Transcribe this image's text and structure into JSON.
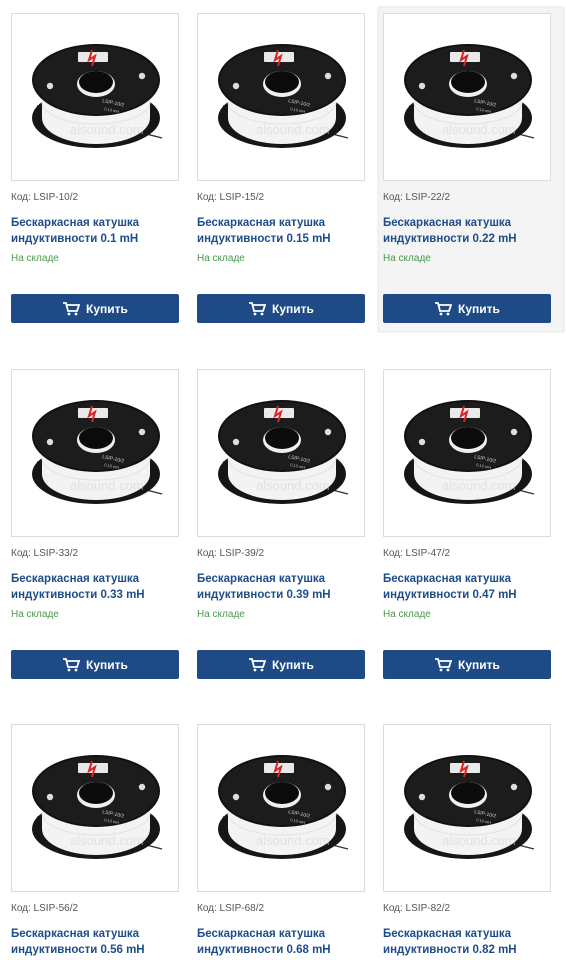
{
  "products": [
    {
      "code": "Код: LSIP-10/2",
      "title": "Бескаркасная катушка индуктивности 0.1 mH",
      "stock": "На складе",
      "button": "Купить",
      "label": "LSIP-10/2"
    },
    {
      "code": "Код: LSIP-15/2",
      "title": "Бескаркасная катушка индуктивности 0.15 mH",
      "stock": "На складе",
      "button": "Купить",
      "label": "LSIP-10/2"
    },
    {
      "code": "Код: LSIP-22/2",
      "title": "Бескаркасная катушка индуктивности 0.22 mH",
      "stock": "На складе",
      "button": "Купить",
      "label": "LSIP-10/2"
    },
    {
      "code": "Код: LSIP-33/2",
      "title": "Бескаркасная катушка индуктивности 0.33 mH",
      "stock": "На складе",
      "button": "Купить",
      "label": "LSIP-10/2"
    },
    {
      "code": "Код: LSIP-39/2",
      "title": "Бескаркасная катушка индуктивности 0.39 mH",
      "stock": "На складе",
      "button": "Купить",
      "label": "LSIP-10/2"
    },
    {
      "code": "Код: LSIP-47/2",
      "title": "Бескаркасная катушка индуктивности 0.47 mH",
      "stock": "На складе",
      "button": "Купить",
      "label": "LSIP-10/2"
    },
    {
      "code": "Код: LSIP-56/2",
      "title": "Бескаркасная катушка индуктивности 0.56 mH",
      "stock": "",
      "button": "",
      "label": "LSIP-10/2"
    },
    {
      "code": "Код: LSIP-68/2",
      "title": "Бескаркасная катушка индуктивности 0.68 mH",
      "stock": "",
      "button": "",
      "label": "LSIP-10/2"
    },
    {
      "code": "Код: LSIP-82/2",
      "title": "Бескаркасная катушка индуктивности 0.82 mH",
      "stock": "",
      "button": "",
      "label": "LSIP-10/2"
    }
  ],
  "watermark": "alsound.com",
  "colors": {
    "button": "#1e4b86",
    "title": "#1d4d8a",
    "stock": "#4a9a4a"
  },
  "icons": {
    "product": "coil-image",
    "button": "cart-icon"
  }
}
